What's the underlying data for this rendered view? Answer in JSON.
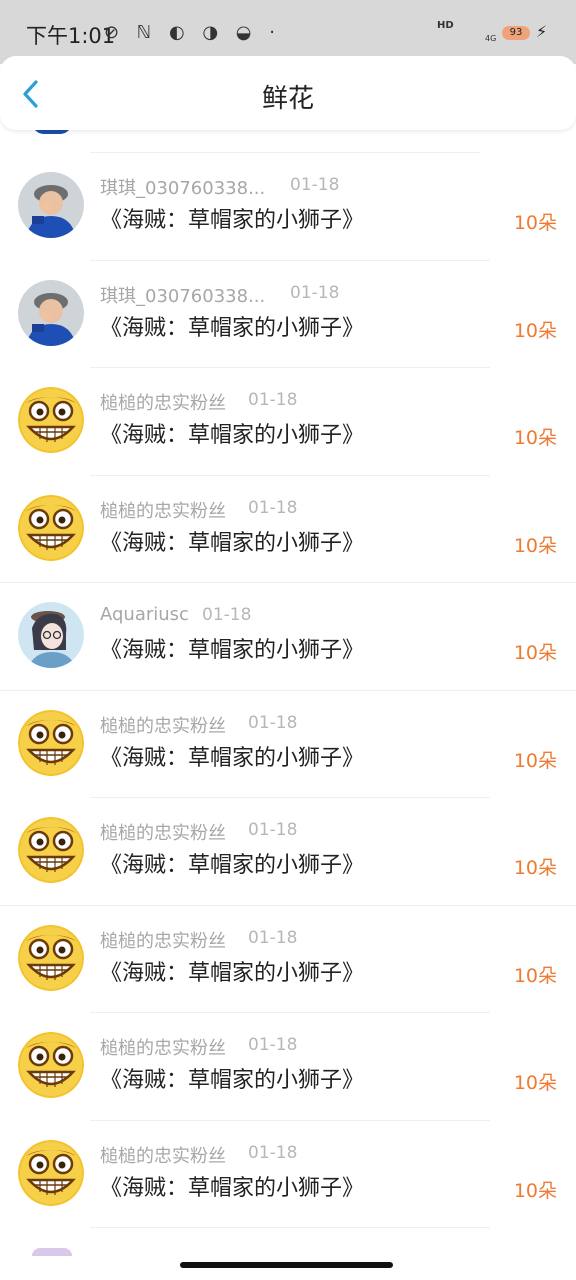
{
  "status": {
    "time": "下午1:01",
    "icons": "⊘ ℕ ◐ ◑ ◒ ·",
    "hd": "HD",
    "net": "4G",
    "battery": "93",
    "bolt": "⚡"
  },
  "nav": {
    "title": "鲜花"
  },
  "rows": [
    {
      "name": "琪琪_030760338...",
      "date": "01-18",
      "gift": "《海贼：草帽家的小狮子》",
      "count": "10朵",
      "avatar": "kid"
    },
    {
      "name": "琪琪_030760338...",
      "date": "01-18",
      "gift": "《海贼：草帽家的小狮子》",
      "count": "10朵",
      "avatar": "kid"
    },
    {
      "name": "槌槌的忠实粉丝",
      "date": "01-18",
      "gift": "《海贼：草帽家的小狮子》",
      "count": "10朵",
      "avatar": "grin"
    },
    {
      "name": "槌槌的忠实粉丝",
      "date": "01-18",
      "gift": "《海贼：草帽家的小狮子》",
      "count": "10朵",
      "avatar": "grin"
    },
    {
      "name": "Aquariusc",
      "date": "01-18",
      "gift": "《海贼：草帽家的小狮子》",
      "count": "10朵",
      "avatar": "anime"
    },
    {
      "name": "槌槌的忠实粉丝",
      "date": "01-18",
      "gift": "《海贼：草帽家的小狮子》",
      "count": "10朵",
      "avatar": "grin"
    },
    {
      "name": "槌槌的忠实粉丝",
      "date": "01-18",
      "gift": "《海贼：草帽家的小狮子》",
      "count": "10朵",
      "avatar": "grin"
    },
    {
      "name": "槌槌的忠实粉丝",
      "date": "01-18",
      "gift": "《海贼：草帽家的小狮子》",
      "count": "10朵",
      "avatar": "grin"
    },
    {
      "name": "槌槌的忠实粉丝",
      "date": "01-18",
      "gift": "《海贼：草帽家的小狮子》",
      "count": "10朵",
      "avatar": "grin"
    },
    {
      "name": "槌槌的忠实粉丝",
      "date": "01-18",
      "gift": "《海贼：草帽家的小狮子》",
      "count": "10朵",
      "avatar": "grin"
    }
  ]
}
